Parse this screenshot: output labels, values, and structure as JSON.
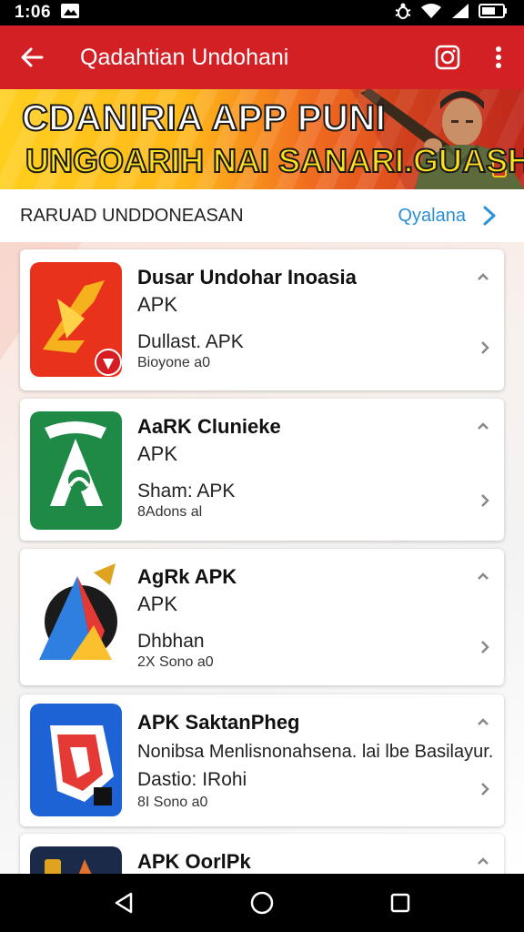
{
  "status_bar": {
    "time": "1:06",
    "icons": [
      "gallery-icon",
      "bug-icon",
      "wifi-icon",
      "signal-icon",
      "battery-icon"
    ]
  },
  "app_bar": {
    "title": "Qadahtian Undohani",
    "icons": [
      "back-arrow-icon",
      "instagram-icon",
      "more-vert-icon"
    ]
  },
  "banner": {
    "line1": "CDANIRIA APP PUNI",
    "line2": "UNGOARIH NAI SANARI.GUASH"
  },
  "section": {
    "label": "RARUAD UNDDONEASAN",
    "more_label": "Qyalana"
  },
  "apps": [
    {
      "name": "Dusar Undohar Inoasia",
      "type": "APK",
      "detail": "Dullast. APK",
      "sub": "Bioyone a0",
      "icon": "app-icon-red-arrow"
    },
    {
      "name": "AaRK Clunieke",
      "type": "APK",
      "detail": "Sham: APK",
      "sub": "8Adons al",
      "icon": "app-icon-green-a"
    },
    {
      "name": "AgRk APK",
      "type": "APK",
      "detail": "Dhbhan",
      "sub": "2X Sono a0",
      "icon": "app-icon-play-triangle"
    },
    {
      "name": "APK SaktanPheg",
      "desc": "Nonibsa Menlisnonahsena. lai lbe Basilayur.",
      "detail": "Dastio: IRohi",
      "sub": "8I Sono a0",
      "icon": "app-icon-blue-shield"
    },
    {
      "name": "APK OorlPk",
      "icon": "app-icon-dark"
    }
  ],
  "nav_bar": {
    "icons": [
      "nav-back-icon",
      "nav-home-icon",
      "nav-recents-icon"
    ]
  },
  "colors": {
    "app_bar": "#d32025",
    "accent_link": "#2a8fd6"
  }
}
